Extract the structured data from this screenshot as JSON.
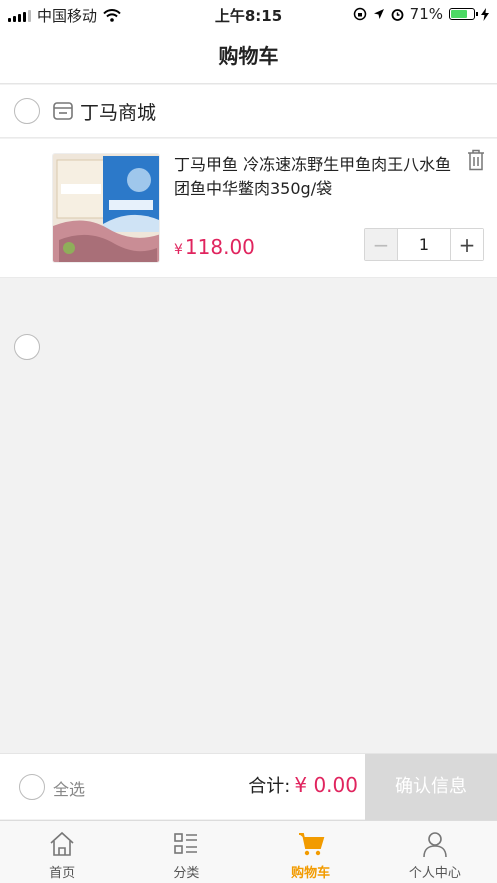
{
  "status_bar": {
    "carrier": "中国移动",
    "time": "上午8:15",
    "battery": "71%",
    "battery_level": 0.71
  },
  "nav": {
    "title": "购物车"
  },
  "shop": {
    "name": "丁马商城"
  },
  "item": {
    "title": "丁马甲鱼 冷冻速冻野生甲鱼肉王八水鱼团鱼中华鳖肉350g/袋",
    "currency": "¥",
    "price": "118.00",
    "quantity": "1",
    "image_label": "丁马甲鱼肉"
  },
  "checkout": {
    "select_all": "全选",
    "total_label": "合计:",
    "total_amount": "¥ 0.00",
    "confirm": "确认信息"
  },
  "tabs": [
    {
      "label": "首页",
      "icon": "home-icon"
    },
    {
      "label": "分类",
      "icon": "category-icon"
    },
    {
      "label": "购物车",
      "icon": "cart-icon"
    },
    {
      "label": "个人中心",
      "icon": "user-icon"
    }
  ],
  "colors": {
    "accent": "#f29b00",
    "price": "#e0245e",
    "confirm_disabled": "#d9d9d9"
  }
}
